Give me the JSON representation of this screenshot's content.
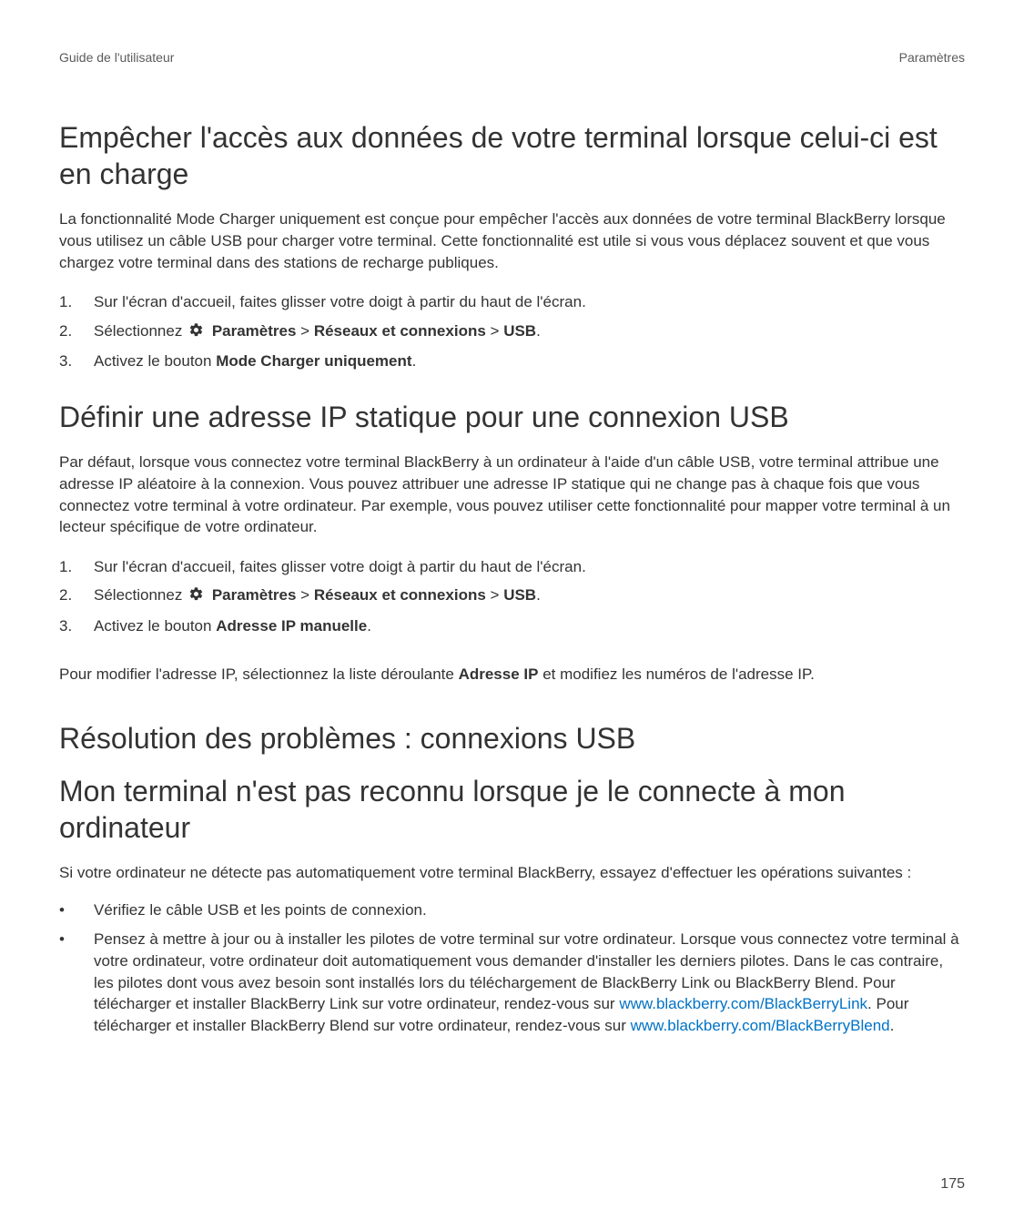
{
  "header": {
    "left": "Guide de l'utilisateur",
    "right": "Paramètres"
  },
  "sections": {
    "s1": {
      "title": "Empêcher l'accès aux données de votre terminal lorsque celui-ci est en charge",
      "para1": "La fonctionnalité Mode Charger uniquement est conçue pour empêcher l'accès aux données de votre terminal BlackBerry lorsque vous utilisez un câble USB pour charger votre terminal. Cette fonctionnalité est utile si vous vous déplacez souvent et que vous chargez votre terminal dans des stations de recharge publiques.",
      "step1": "Sur l'écran d'accueil, faites glisser votre doigt à partir du haut de l'écran.",
      "step2_pre": "Sélectionnez ",
      "step2_b1": "Paramètres",
      "step2_sep": " > ",
      "step2_b2": "Réseaux et connexions",
      "step2_b3": "USB",
      "step2_end": ".",
      "step3_pre": "Activez le bouton ",
      "step3_b": "Mode Charger uniquement",
      "step3_end": "."
    },
    "s2": {
      "title": "Définir une adresse IP statique pour une connexion USB",
      "para1": "Par défaut, lorsque vous connectez votre terminal BlackBerry à un ordinateur à l'aide d'un câble USB, votre terminal attribue une adresse IP aléatoire à la connexion. Vous pouvez attribuer une adresse IP statique qui ne change pas à chaque fois que vous connectez votre terminal à votre ordinateur. Par exemple, vous pouvez utiliser cette fonctionnalité pour mapper votre terminal à un lecteur spécifique de votre ordinateur.",
      "step1": "Sur l'écran d'accueil, faites glisser votre doigt à partir du haut de l'écran.",
      "step2_pre": "Sélectionnez ",
      "step2_b1": "Paramètres",
      "step2_sep": " > ",
      "step2_b2": "Réseaux et connexions",
      "step2_b3": "USB",
      "step2_end": ".",
      "step3_pre": "Activez le bouton ",
      "step3_b": "Adresse IP manuelle",
      "step3_end": ".",
      "para2_pre": "Pour modifier l'adresse IP, sélectionnez la liste déroulante ",
      "para2_b": "Adresse IP",
      "para2_end": " et modifiez les numéros de l'adresse IP."
    },
    "s3": {
      "title": "Résolution des problèmes : connexions USB"
    },
    "s4": {
      "title": "Mon terminal n'est pas reconnu lorsque je le connecte à mon ordinateur",
      "para1": "Si votre ordinateur ne détecte pas automatiquement votre terminal BlackBerry, essayez d'effectuer les opérations suivantes :",
      "bullet1": "Vérifiez le câble USB et les points de connexion.",
      "bullet2_a": "Pensez à mettre à jour ou à installer les pilotes de votre terminal sur votre ordinateur. Lorsque vous connectez votre terminal à votre ordinateur, votre ordinateur doit automatiquement vous demander d'installer les derniers pilotes. Dans le cas contraire, les pilotes dont vous avez besoin sont installés lors du téléchargement de BlackBerry Link ou BlackBerry Blend. Pour télécharger et installer BlackBerry Link sur votre ordinateur, rendez-vous sur ",
      "bullet2_link1": "www.blackberry.com/BlackBerryLink",
      "bullet2_b": ". Pour télécharger et installer BlackBerry Blend sur votre ordinateur, rendez-vous sur ",
      "bullet2_link2": "www.blackberry.com/BlackBerryBlend",
      "bullet2_c": "."
    }
  },
  "pageNumber": "175"
}
